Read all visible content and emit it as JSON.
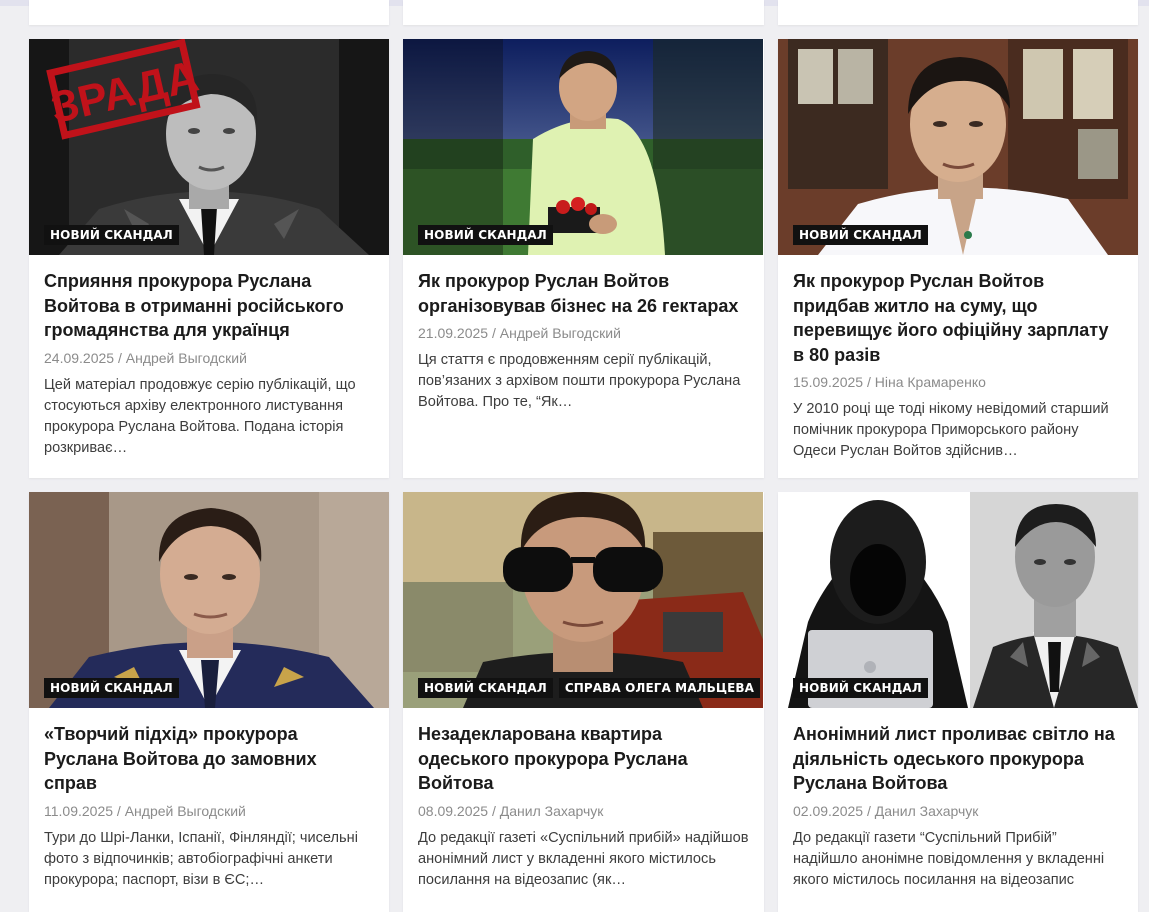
{
  "badges": {
    "new_scandal": "НОВИЙ СКАНДАЛ",
    "maltsev_case": "СПРАВА ОЛЕГА МАЛЬЦЕВА"
  },
  "meta_separator": "/",
  "stamp_text": "ЗРАДА",
  "articles": [
    {
      "title": "Сприяння прокурора Руслана Войтова в отриманні російського громадянства для українця",
      "date": "24.09.2025",
      "author": "Андрей Выгодский",
      "excerpt": "Цей матеріал продовжує серію публікацій, що стосуються архіву електронного листування прокурора Руслана Войтова. Подана історія розкриває…"
    },
    {
      "title": "Як прокурор Руслан Войтов організовував бізнес на 26 гектарах",
      "date": "21.09.2025",
      "author": "Андрей Выгодский",
      "excerpt": "Ця стаття є продовженням серії публікацій, пов’язаних з архівом пошти прокурора Руслана Войтова. Про те, “Як…"
    },
    {
      "title": "Як прокурор Руслан Войтов придбав житло на суму, що перевищує його офіційну зарплату в 80 разів",
      "date": "15.09.2025",
      "author": "Ніна Крамаренко",
      "excerpt": "У 2010 році ще тоді нікому невідомий старший помічник прокурора Приморського району Одеси Руслан Войтов здійснив…"
    },
    {
      "title": "«Творчий підхід» прокурора Руслана Войтова до замовних справ",
      "date": "11.09.2025",
      "author": "Андрей Выгодский",
      "excerpt": "Тури до Шрі-Ланки, Іспанії, Фінляндії; чисельні фото з відпочинків; автобіографічні анкети прокурора; паспорт, візи в ЄС;…"
    },
    {
      "title": "Незадекларована квартира одеського прокурора Руслана Войтова",
      "date": "08.09.2025",
      "author": "Данил Захарчук",
      "excerpt": "До редакції газеті «Суспільний прибій» надійшов анонімний лист у вкладенні якого містилось посилання на відеозапис (як…"
    },
    {
      "title": "Анонімний лист проливає світло на діяльність одеського прокурора Руслана Войтова",
      "date": "02.09.2025",
      "author": "Данил Захарчук",
      "excerpt": "До редакції газети “Суспільний Прибій” надійшло анонімне повідомлення у вкладенні якого містилось посилання на відеозапис"
    }
  ]
}
